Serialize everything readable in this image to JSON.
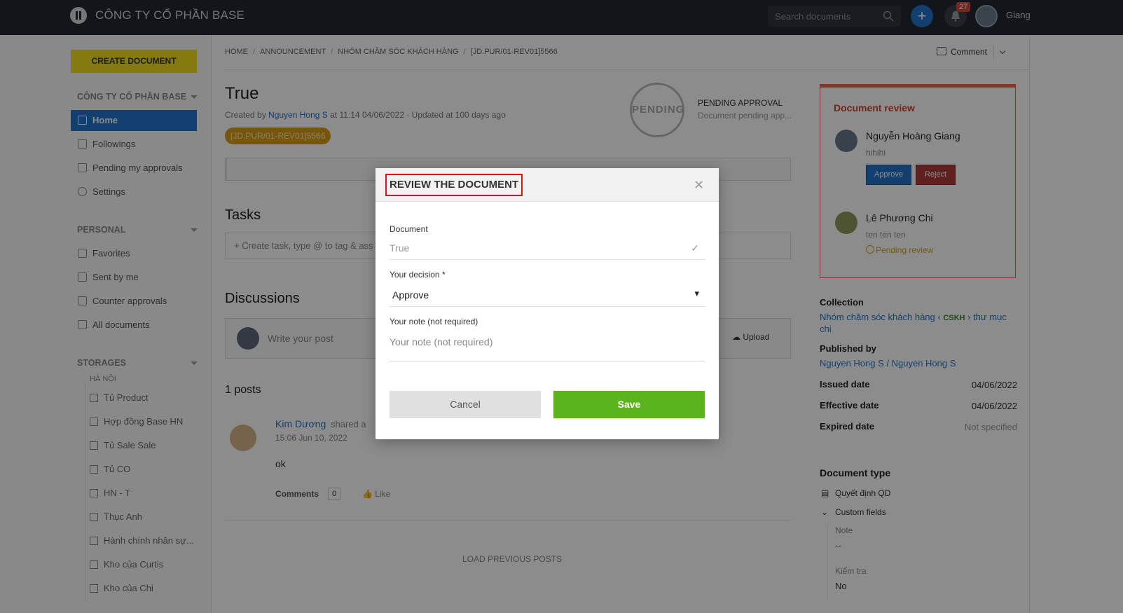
{
  "topbar": {
    "company": "CÔNG TY CỔ PHẦN BASE",
    "search_placeholder": "Search documents",
    "notifications_count": "27",
    "username": "Giang"
  },
  "sidebar": {
    "create_label": "CREATE DOCUMENT",
    "company_section": "CÔNG TY CỔ PHẦN BASE",
    "nav": [
      "Home",
      "Followings",
      "Pending my approvals",
      "Settings"
    ],
    "personal_title": "PERSONAL",
    "personal": [
      "Favorites",
      "Sent by me",
      "Counter approvals",
      "All documents"
    ],
    "storages_title": "STORAGES",
    "storage_group": "HÀ NỘI",
    "storages": [
      "Tủ Product",
      "Hợp đồng Base HN",
      "Tủ Sale Sale",
      "Tủ CO",
      "HN - T",
      "Thục Anh",
      "Hành chính nhân sự...",
      "Kho của Curtis",
      "Kho của Chi"
    ]
  },
  "breadcrumb": [
    "HOME",
    "ANNOUNCEMENT",
    "NHÓM CHĂM SÓC KHÁCH HÀNG",
    "[JD.PUR/01-REV01]5566"
  ],
  "header_actions": {
    "comment": "Comment"
  },
  "document": {
    "title": "True",
    "created_prefix": "Created by",
    "author": "Nguyen Hong S",
    "created_suffix": "at 11:14 04/06/2022 · Updated at 100 days ago",
    "tag": "[JD.PUR/01-REV01]5566",
    "stamp": "PENDING",
    "status_title": "PENDING APPROVAL",
    "status_sub": "Document pending app..."
  },
  "tasks": {
    "title": "Tasks",
    "placeholder": "Create task, type @ to tag & ass"
  },
  "discussions": {
    "title": "Discussions",
    "placeholder": "Write your post",
    "upload": "Upload",
    "count_label": "1 posts",
    "post": {
      "author": "Kim Dương",
      "action": "shared a",
      "time": "15:06 Jun 10, 2022",
      "text": "ok",
      "comments_label": "Comments",
      "comments_count": "0",
      "like": "Like"
    },
    "load_previous": "LOAD PREVIOUS POSTS"
  },
  "review_panel": {
    "title": "Document review",
    "reviewers": [
      {
        "name": "Nguyễn Hoàng Giang",
        "note": "hihihi",
        "approve": "Approve",
        "reject": "Reject"
      },
      {
        "name": "Lê Phương Chi",
        "note": "ten ten ten",
        "status": "Pending review"
      }
    ]
  },
  "info": {
    "collection_label": "Collection",
    "collection_a": "Nhóm chăm sóc khách hàng",
    "collection_code": "CSKH",
    "collection_b": "thư mục chi",
    "published_label": "Published by",
    "published_value": "Nguyen Hong S / Nguyen Hong S",
    "issued_label": "Issued date",
    "issued_value": "04/06/2022",
    "effective_label": "Effective date",
    "effective_value": "04/06/2022",
    "expired_label": "Expired date",
    "expired_value": "Not specified",
    "doc_type_label": "Document type",
    "doc_type_value": "Quyết định QD",
    "custom_fields_label": "Custom fields",
    "note_label": "Note",
    "note_value": "--",
    "check_label": "Kiểm tra",
    "check_value": "No"
  },
  "modal": {
    "title": "REVIEW THE DOCUMENT",
    "document_label": "Document",
    "document_value": "True",
    "decision_label": "Your decision *",
    "decision_value": "Approve",
    "note_label": "Your note (not required)",
    "note_placeholder": "Your note (not required)",
    "cancel": "Cancel",
    "save": "Save"
  },
  "colors": {
    "brand": "#2173c9",
    "create": "#f0de1c",
    "save": "#5ab51c",
    "review_border": "#e46a4e"
  }
}
